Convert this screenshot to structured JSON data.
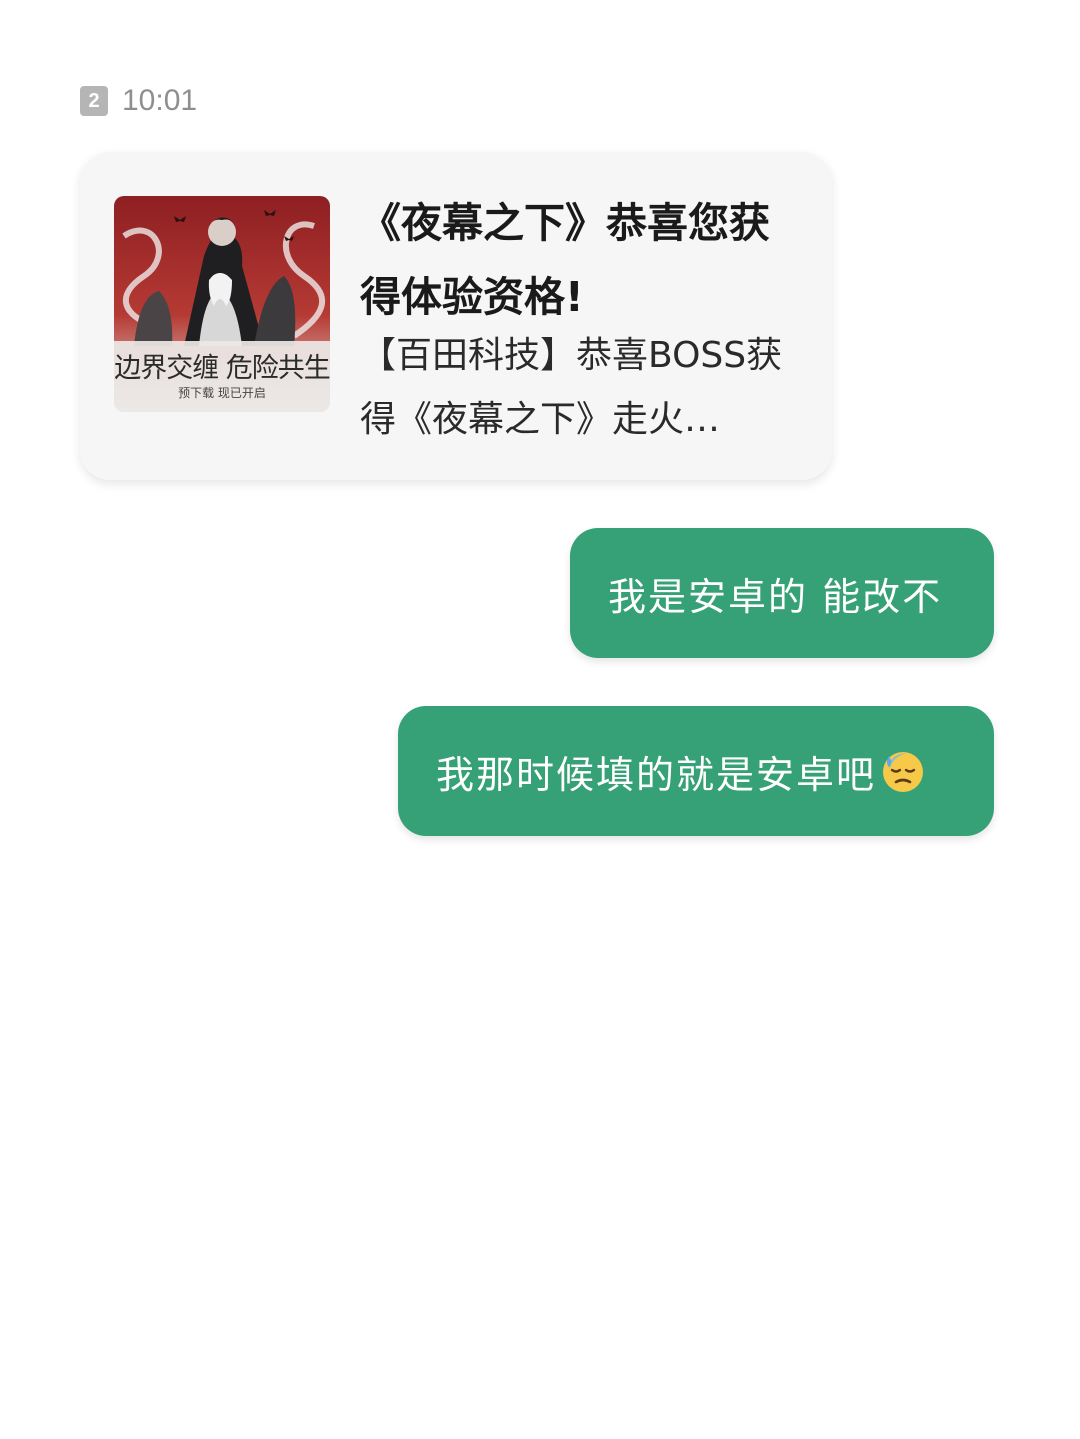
{
  "status": {
    "sim_badge": "2",
    "time": "10:01"
  },
  "card": {
    "thumbnail": {
      "caption": "边界交缠 危险共生",
      "sub_caption": "预下载 现已开启"
    },
    "title": "《夜幕之下》恭喜您获得体验资格!",
    "description": "【百田科技】恭喜BOSS获得《夜幕之下》走火…"
  },
  "messages": [
    {
      "text": "我是安卓的 能改不",
      "emoji": null
    },
    {
      "text": "我那时候填的就是安卓吧",
      "emoji": "downcast-face-with-sweat-icon"
    }
  ],
  "colors": {
    "bubble_green": "#36a176",
    "card_bg": "#f6f6f6",
    "time_gray": "#8f8f8f"
  }
}
